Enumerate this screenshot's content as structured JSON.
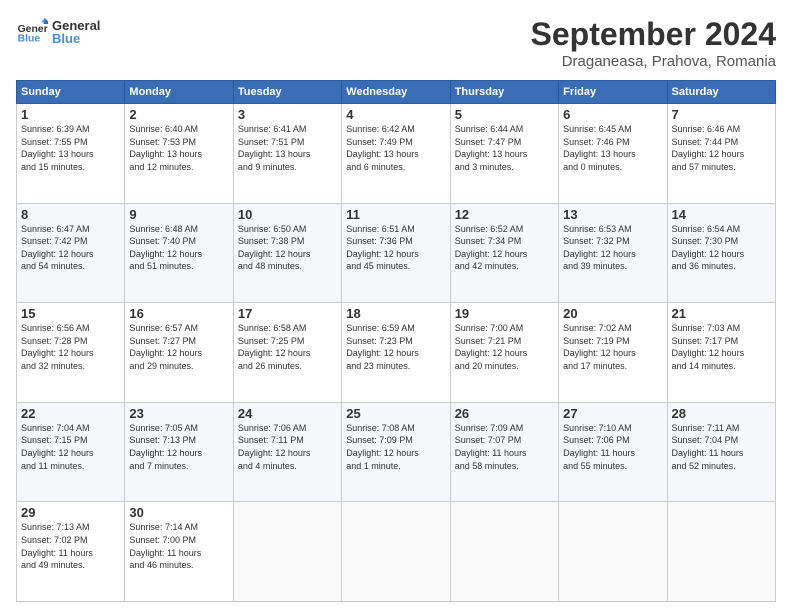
{
  "header": {
    "logo_general": "General",
    "logo_blue": "Blue",
    "title": "September 2024",
    "subtitle": "Draganeasa, Prahova, Romania"
  },
  "days_of_week": [
    "Sunday",
    "Monday",
    "Tuesday",
    "Wednesday",
    "Thursday",
    "Friday",
    "Saturday"
  ],
  "weeks": [
    [
      {
        "day": "1",
        "sunrise": "6:39 AM",
        "sunset": "7:55 PM",
        "daylight": "13 hours and 15 minutes."
      },
      {
        "day": "2",
        "sunrise": "6:40 AM",
        "sunset": "7:53 PM",
        "daylight": "13 hours and 12 minutes."
      },
      {
        "day": "3",
        "sunrise": "6:41 AM",
        "sunset": "7:51 PM",
        "daylight": "13 hours and 9 minutes."
      },
      {
        "day": "4",
        "sunrise": "6:42 AM",
        "sunset": "7:49 PM",
        "daylight": "13 hours and 6 minutes."
      },
      {
        "day": "5",
        "sunrise": "6:44 AM",
        "sunset": "7:47 PM",
        "daylight": "13 hours and 3 minutes."
      },
      {
        "day": "6",
        "sunrise": "6:45 AM",
        "sunset": "7:46 PM",
        "daylight": "13 hours and 0 minutes."
      },
      {
        "day": "7",
        "sunrise": "6:46 AM",
        "sunset": "7:44 PM",
        "daylight": "12 hours and 57 minutes."
      }
    ],
    [
      {
        "day": "8",
        "sunrise": "6:47 AM",
        "sunset": "7:42 PM",
        "daylight": "12 hours and 54 minutes."
      },
      {
        "day": "9",
        "sunrise": "6:48 AM",
        "sunset": "7:40 PM",
        "daylight": "12 hours and 51 minutes."
      },
      {
        "day": "10",
        "sunrise": "6:50 AM",
        "sunset": "7:38 PM",
        "daylight": "12 hours and 48 minutes."
      },
      {
        "day": "11",
        "sunrise": "6:51 AM",
        "sunset": "7:36 PM",
        "daylight": "12 hours and 45 minutes."
      },
      {
        "day": "12",
        "sunrise": "6:52 AM",
        "sunset": "7:34 PM",
        "daylight": "12 hours and 42 minutes."
      },
      {
        "day": "13",
        "sunrise": "6:53 AM",
        "sunset": "7:32 PM",
        "daylight": "12 hours and 39 minutes."
      },
      {
        "day": "14",
        "sunrise": "6:54 AM",
        "sunset": "7:30 PM",
        "daylight": "12 hours and 36 minutes."
      }
    ],
    [
      {
        "day": "15",
        "sunrise": "6:56 AM",
        "sunset": "7:28 PM",
        "daylight": "12 hours and 32 minutes."
      },
      {
        "day": "16",
        "sunrise": "6:57 AM",
        "sunset": "7:27 PM",
        "daylight": "12 hours and 29 minutes."
      },
      {
        "day": "17",
        "sunrise": "6:58 AM",
        "sunset": "7:25 PM",
        "daylight": "12 hours and 26 minutes."
      },
      {
        "day": "18",
        "sunrise": "6:59 AM",
        "sunset": "7:23 PM",
        "daylight": "12 hours and 23 minutes."
      },
      {
        "day": "19",
        "sunrise": "7:00 AM",
        "sunset": "7:21 PM",
        "daylight": "12 hours and 20 minutes."
      },
      {
        "day": "20",
        "sunrise": "7:02 AM",
        "sunset": "7:19 PM",
        "daylight": "12 hours and 17 minutes."
      },
      {
        "day": "21",
        "sunrise": "7:03 AM",
        "sunset": "7:17 PM",
        "daylight": "12 hours and 14 minutes."
      }
    ],
    [
      {
        "day": "22",
        "sunrise": "7:04 AM",
        "sunset": "7:15 PM",
        "daylight": "12 hours and 11 minutes."
      },
      {
        "day": "23",
        "sunrise": "7:05 AM",
        "sunset": "7:13 PM",
        "daylight": "12 hours and 7 minutes."
      },
      {
        "day": "24",
        "sunrise": "7:06 AM",
        "sunset": "7:11 PM",
        "daylight": "12 hours and 4 minutes."
      },
      {
        "day": "25",
        "sunrise": "7:08 AM",
        "sunset": "7:09 PM",
        "daylight": "12 hours and 1 minute."
      },
      {
        "day": "26",
        "sunrise": "7:09 AM",
        "sunset": "7:07 PM",
        "daylight": "11 hours and 58 minutes."
      },
      {
        "day": "27",
        "sunrise": "7:10 AM",
        "sunset": "7:06 PM",
        "daylight": "11 hours and 55 minutes."
      },
      {
        "day": "28",
        "sunrise": "7:11 AM",
        "sunset": "7:04 PM",
        "daylight": "11 hours and 52 minutes."
      }
    ],
    [
      {
        "day": "29",
        "sunrise": "7:13 AM",
        "sunset": "7:02 PM",
        "daylight": "11 hours and 49 minutes."
      },
      {
        "day": "30",
        "sunrise": "7:14 AM",
        "sunset": "7:00 PM",
        "daylight": "11 hours and 46 minutes."
      },
      null,
      null,
      null,
      null,
      null
    ]
  ]
}
